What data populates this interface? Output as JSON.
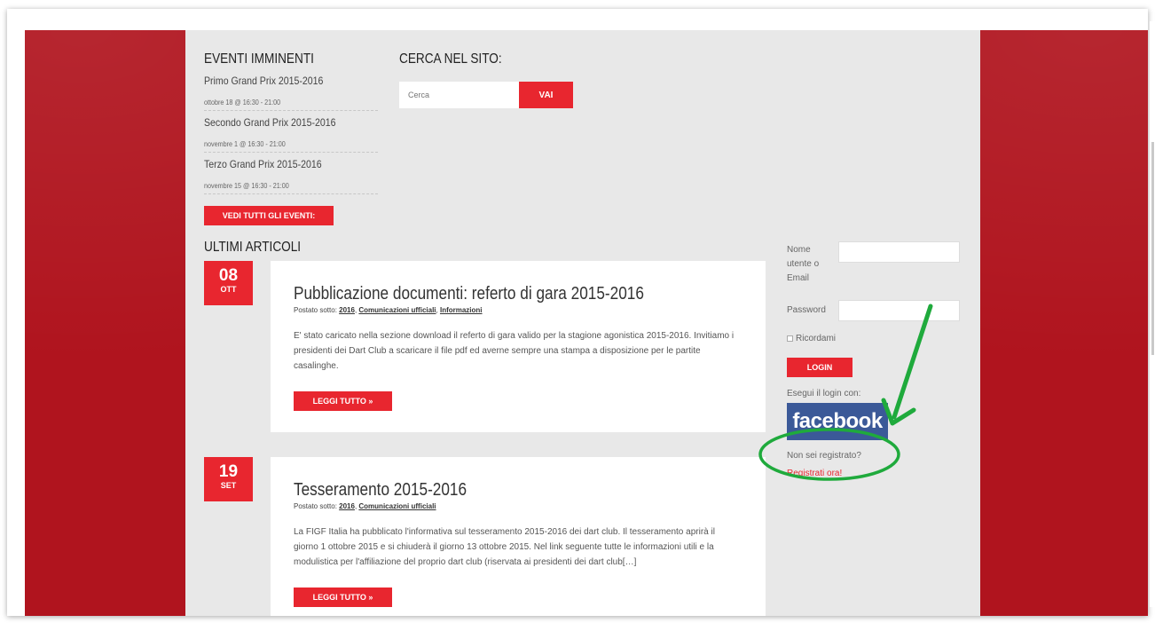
{
  "events": {
    "heading": "EVENTI IMMINENTI",
    "items": [
      {
        "title": "Primo Grand Prix 2015-2016",
        "date": "ottobre 18 @ 16:30 - 21:00"
      },
      {
        "title": "Secondo Grand Prix 2015-2016",
        "date": "novembre 1 @ 16:30 - 21:00"
      },
      {
        "title": "Terzo Grand Prix 2015-2016",
        "date": "novembre 15 @ 16:30 - 21:00"
      }
    ],
    "all_button": "VEDI TUTTI GLI EVENTI:"
  },
  "search": {
    "heading": "CERCA NEL SITO:",
    "placeholder": "Cerca",
    "button": "VAI"
  },
  "articles": {
    "heading": "ULTIMI ARTICOLI",
    "items": [
      {
        "day": "08",
        "month": "OTT",
        "title": "Pubblicazione documenti: referto di gara 2015-2016",
        "meta_prefix": "Postato sotto: ",
        "categories": [
          "2016",
          "Comunicazioni ufficiali",
          "Informazioni"
        ],
        "excerpt": "E' stato caricato nella sezione download il referto di gara valido per la stagione agonistica 2015-2016. Invitiamo i presidenti dei Dart Club a scaricare il file pdf ed averne sempre una stampa a disposizione per le partite casalinghe.",
        "read_more": "LEGGI TUTTO »"
      },
      {
        "day": "19",
        "month": "SET",
        "title": "Tesseramento 2015-2016",
        "meta_prefix": "Postato sotto: ",
        "categories": [
          "2016",
          "Comunicazioni ufficiali"
        ],
        "excerpt": "La FIGF Italia ha pubblicato l'informativa sul tesseramento 2015-2016 dei dart club. Il tesseramento aprirà il giorno 1 ottobre 2015 e si chiuderà il giorno 13 ottobre 2015. Nel link seguente tutte le informazioni utili e la modulistica per l'affiliazione del proprio dart club (riservata ai presidenti dei dart club[…]",
        "read_more": "LEGGI TUTTO »"
      }
    ]
  },
  "login": {
    "username_label": "Nome utente o Email",
    "password_label": "Password",
    "remember_label": "Ricordami",
    "login_button": "LOGIN",
    "social_label": "Esegui il login con:",
    "facebook_label": "facebook",
    "not_registered": "Non sei registrato?",
    "register_link": "Registrati ora!"
  },
  "colors": {
    "brand_red": "#b0141e",
    "accent_red": "#e8262f",
    "annotation_green": "#1faa3c",
    "facebook_blue": "#3b5998"
  }
}
